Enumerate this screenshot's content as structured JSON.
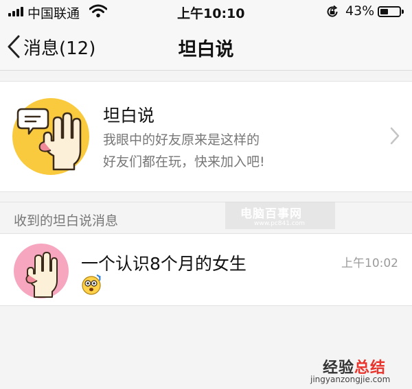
{
  "status_bar": {
    "carrier": "中国联通",
    "time": "上午10:10",
    "battery_percent": "43%",
    "battery_level": 0.43
  },
  "nav": {
    "back_label": "消息(12)",
    "title": "坦白说"
  },
  "card": {
    "title": "坦白说",
    "desc_line1": "我眼中的好友原来是这样的",
    "desc_line2": "好友们都在玩，快来加入吧!",
    "logo_icon": "hand-speech-bubble-icon",
    "logo_bg": "#f9c93e"
  },
  "section": {
    "label": "收到的坦白说消息"
  },
  "message": {
    "sender": "一个认识8个月的女生",
    "time": "上午10:02",
    "emoji": "surprised-emoji-icon",
    "avatar_bg": "#f7a6c0"
  },
  "watermarks": {
    "top_title": "电脑百事网",
    "top_url": "www.pc841.com",
    "bottom_title_a": "经验",
    "bottom_title_b": "总结",
    "bottom_url": "jingyanzongjie.com"
  }
}
